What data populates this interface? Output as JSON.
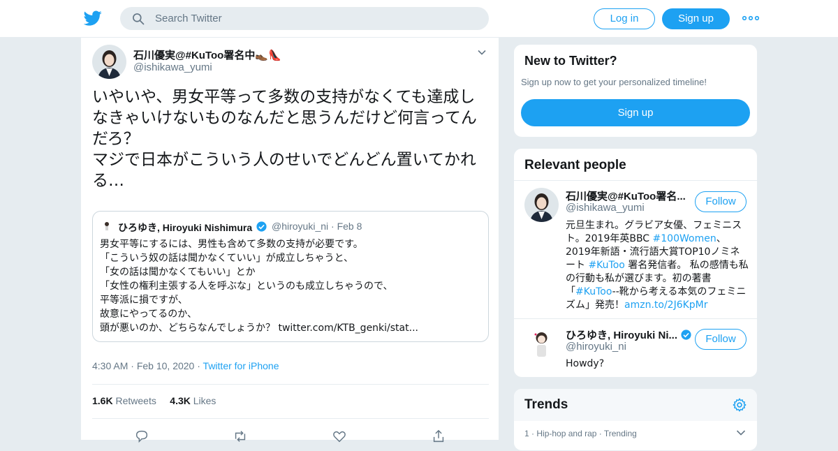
{
  "header": {
    "search_placeholder": "Search Twitter",
    "login_label": "Log in",
    "signup_label": "Sign up"
  },
  "tweet": {
    "author_name": "石川優実@#KuToo署名中👞👠",
    "author_handle": "@ishikawa_yumi",
    "text": "いやいや、男女平等って多数の支持がなくても達成しなきゃいけないものなんだと思うんだけど何言ってんだろ？\nマジで日本がこういう人のせいでどんどん置いてかれる…",
    "quote": {
      "name": "ひろゆき, Hiroyuki Nishimura",
      "handle": "@hiroyuki_ni",
      "date": "Feb 8",
      "text": "男女平等にするには、男性も含めて多数の支持が必要です。\n「こういう奴の話は聞かなくていい」が成立しちゃうと、\n「女の話は聞かなくてもいい」とか\n「女性の権利主張する人を呼ぶな」というのも成立しちゃうので、\n平等派に損ですが、\n故意にやってるのか、\n頭が悪いのか、どちらなんでしょうか？ twitter.com/KTB_genki/stat..."
    },
    "time": "4:30 AM",
    "date": "Feb 10, 2020",
    "source": "Twitter for iPhone",
    "retweets_count": "1.6K",
    "retweets_label": "Retweets",
    "likes_count": "4.3K",
    "likes_label": "Likes"
  },
  "sidebar": {
    "new_to_twitter": {
      "title": "New to Twitter?",
      "subtitle": "Sign up now to get your personalized timeline!",
      "button": "Sign up"
    },
    "relevant_people": {
      "title": "Relevant people",
      "people": [
        {
          "name": "石川優実@#KuToo署名...",
          "handle": "@ishikawa_yumi",
          "follow": "Follow",
          "bio_1": "元旦生まれ。グラビア女優、フェミニスト。2019年英BBC ",
          "bio_link_1": "#100Women",
          "bio_2": "、2019年新語・流行語大賞TOP10ノミネート ",
          "bio_link_2": "#KuToo",
          "bio_3": " 署名発信者。 私の感情も私の行動も私が選びます。初の著書「",
          "bio_link_3": "#KuToo",
          "bio_4": "--靴から考える本気のフェミニズム」発売！",
          "bio_link_4": "amzn.to/2J6KpMr"
        },
        {
          "name": "ひろゆき, Hiroyuki Ni...",
          "handle": "@hiroyuki_ni",
          "follow": "Follow",
          "bio": "Howdy?"
        }
      ]
    },
    "trends": {
      "title": "Trends",
      "items": [
        {
          "rank": "1",
          "category": "Hip-hop and rap",
          "status": "Trending"
        }
      ]
    }
  },
  "colors": {
    "accent": "#1da1f2",
    "background": "#e6ecf0",
    "muted": "#657786"
  }
}
